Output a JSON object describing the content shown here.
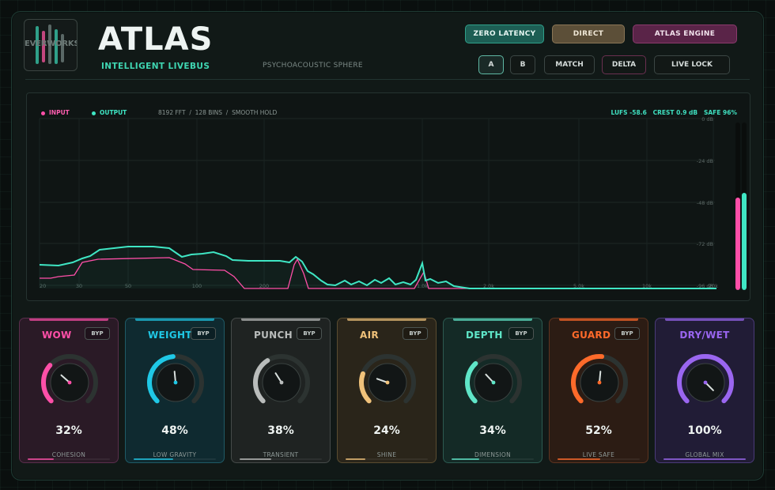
{
  "header": {
    "logo_text": "EVERWORKS",
    "title": "ATLAS",
    "subtitle": "INTELLIGENT LIVEBUS",
    "tagline": "PSYCHOACOUSTIC SPHERE"
  },
  "modes": [
    {
      "label": "ZERO LATENCY",
      "color": "#1f7a6c"
    },
    {
      "label": "DIRECT",
      "color": "#7a6a4a"
    },
    {
      "label": "ATLAS ENGINE",
      "color": "#6b2f57"
    }
  ],
  "toolbar": {
    "a_label": "A",
    "b_label": "B",
    "match_label": "MATCH",
    "delta_label": "DELTA",
    "live_lock_label": "LIVE LOCK"
  },
  "spectrum": {
    "input_label": "INPUT",
    "output_label": "OUTPUT",
    "input_color": "#ff4fa8",
    "output_color": "#3fe6c4",
    "fft_info": "8192 FFT  /  128 BINS  /  SMOOTH HOLD",
    "stats": "LUFS -58.6   CREST 0.9 dB   SAFE 96%",
    "db_labels": [
      "0 dB",
      "-24 dB",
      "-48 dB",
      "-72 dB",
      "-96 dB"
    ],
    "freq_labels": [
      "20",
      "30",
      "50",
      "100",
      "200",
      "1.0k",
      "2.0k",
      "5.0k",
      "10k",
      "20k"
    ],
    "meter_input_level": 0.55,
    "meter_output_level": 0.58
  },
  "modules": [
    {
      "name": "WOW",
      "byp": "BYP",
      "value": "32%",
      "level": 0.32,
      "footer": "COHESION",
      "accent": "#ff4fa8",
      "bg": "#2a1a26",
      "border": "#5a2e4c"
    },
    {
      "name": "WEIGHT",
      "byp": "BYP",
      "value": "48%",
      "level": 0.48,
      "footer": "LOW GRAVITY",
      "accent": "#1fc8e6",
      "bg": "#0f2a30",
      "border": "#1f5a66"
    },
    {
      "name": "PUNCH",
      "byp": "BYP",
      "value": "38%",
      "level": 0.38,
      "footer": "TRANSIENT",
      "accent": "#b9bcbb",
      "bg": "#1f2322",
      "border": "#454a49"
    },
    {
      "name": "AIR",
      "byp": "BYP",
      "value": "24%",
      "level": 0.24,
      "footer": "SHINE",
      "accent": "#f0c27a",
      "bg": "#2a251a",
      "border": "#5a4c30"
    },
    {
      "name": "DEPTH",
      "byp": "BYP",
      "value": "34%",
      "level": 0.34,
      "footer": "DIMENSION",
      "accent": "#5fe6c8",
      "bg": "#142a26",
      "border": "#2c5a50"
    },
    {
      "name": "GUARD",
      "byp": "BYP",
      "value": "52%",
      "level": 0.52,
      "footer": "LIVE SAFE",
      "accent": "#ff6a2a",
      "bg": "#2c1c14",
      "border": "#5e3420"
    },
    {
      "name": "DRY/WET",
      "byp": "",
      "value": "100%",
      "level": 1.0,
      "footer": "GLOBAL MIX",
      "accent": "#9a66f0",
      "bg": "#211c36",
      "border": "#4a3a78"
    }
  ]
}
